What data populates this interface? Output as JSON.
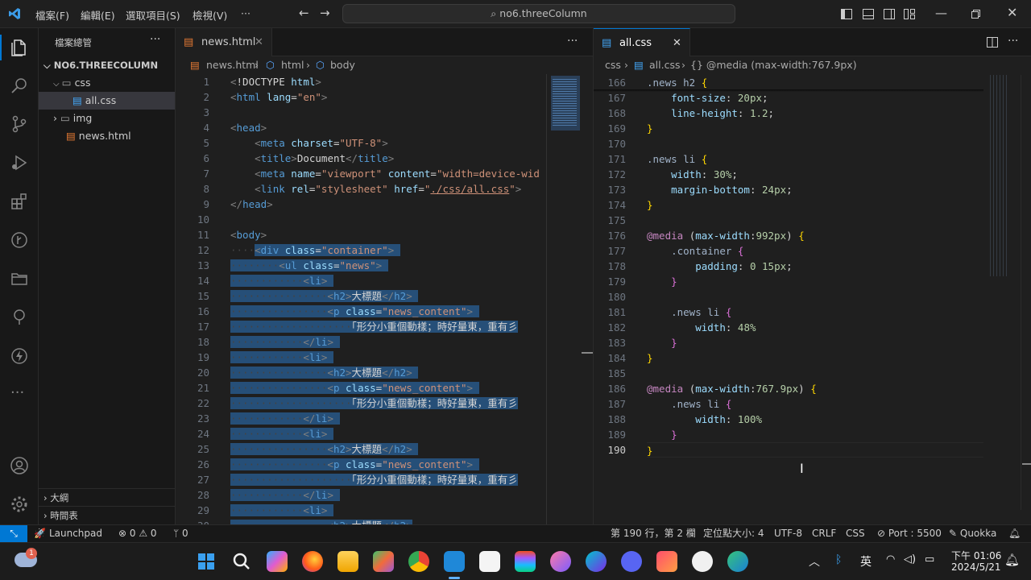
{
  "menu": [
    "檔案(F)",
    "編輯(E)",
    "選取項目(S)",
    "檢視(V)",
    "···"
  ],
  "command_center": "no6.threeColumn",
  "sidebar": {
    "title": "檔案總管",
    "more": "···",
    "root": "NO6.THREECOLUMN",
    "items": [
      {
        "label": "css",
        "kind": "folder-open",
        "indent": 1
      },
      {
        "label": "all.css",
        "kind": "file",
        "indent": 2
      },
      {
        "label": "img",
        "kind": "folder",
        "indent": 1
      },
      {
        "label": "news.html",
        "kind": "file",
        "indent": 1
      }
    ],
    "outline": "大綱",
    "timeline": "時間表"
  },
  "editor_left": {
    "tab": "news.html",
    "breadcrumb": [
      "news.html",
      "html",
      "body"
    ],
    "lines": [
      1,
      2,
      3,
      4,
      5,
      6,
      7,
      8,
      9,
      10,
      11,
      12,
      13,
      14,
      15,
      16,
      17,
      18,
      19,
      20,
      21,
      22,
      23,
      24,
      25,
      26,
      27,
      28,
      29,
      30
    ]
  },
  "editor_right": {
    "tab": "all.css",
    "breadcrumb": [
      "css",
      "all.css",
      "{} @media (max-width:767.9px)"
    ],
    "lines": [
      166,
      167,
      168,
      169,
      170,
      171,
      172,
      173,
      174,
      175,
      176,
      177,
      178,
      179,
      180,
      181,
      182,
      183,
      184,
      185,
      186,
      187,
      188,
      189,
      190
    ],
    "active_line": 190
  },
  "status": {
    "launchpad": "Launchpad",
    "problems": "⊗ 0 ⚠ 0",
    "ports": "ᛘ 0",
    "position": "第 190 行，第 2 欄",
    "tab_size": "定位點大小: 4",
    "encoding": "UTF-8",
    "eol": "CRLF",
    "language": "CSS",
    "port": "Port : 5500",
    "quokka": "Quokka"
  },
  "taskbar": {
    "notification_badge": "1",
    "ime": "英",
    "time": "下午 01:06",
    "date": "2024/5/21"
  }
}
